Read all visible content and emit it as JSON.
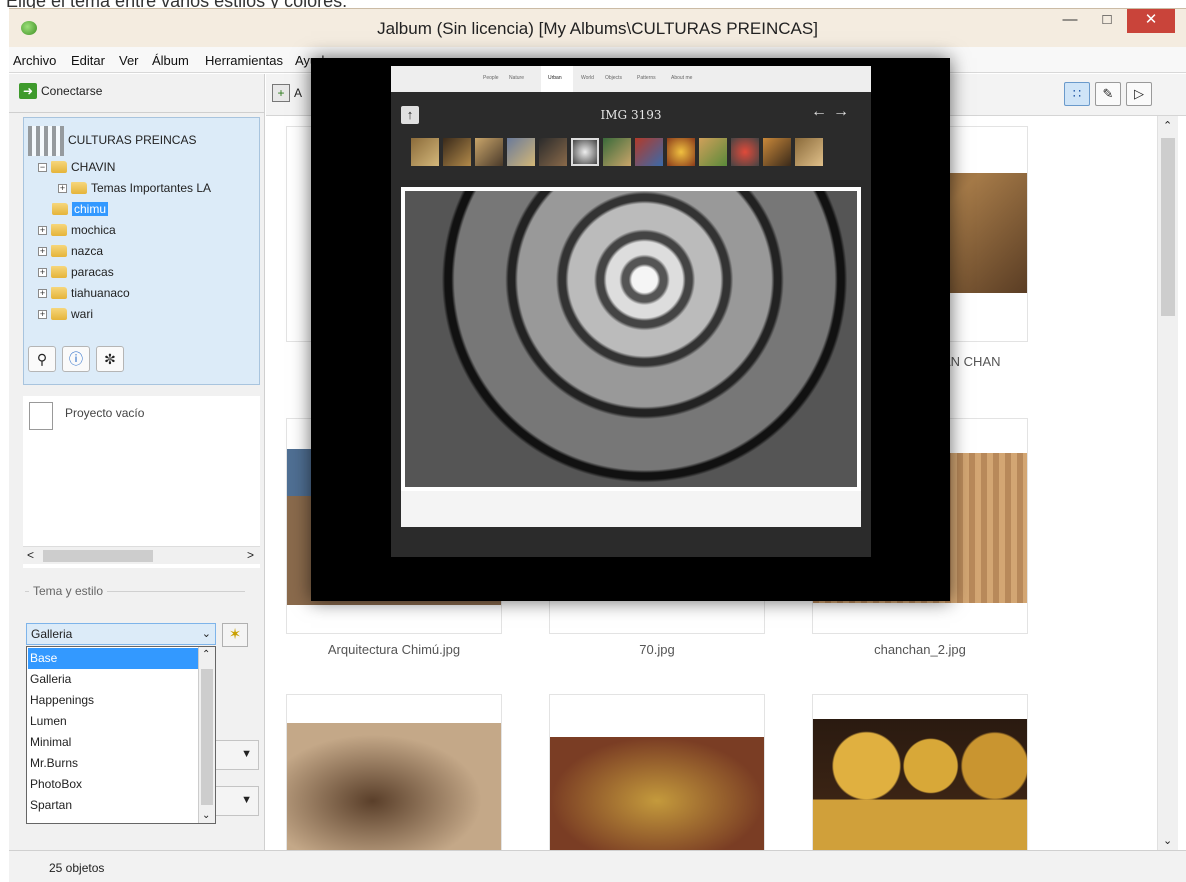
{
  "cropped_caption": "Elige el tema entre varios estilos y colores.",
  "window": {
    "title": "Jalbum (Sin licencia) [My Albums\\CULTURAS PREINCAS]"
  },
  "menu": [
    "Archivo",
    "Editar",
    "Ver",
    "Álbum",
    "Herramientas",
    "Ayuda"
  ],
  "left": {
    "connect_label": "Conectarse",
    "empty_project": "Proyecto vacío",
    "theme_section": "Tema y estilo"
  },
  "tree": {
    "root": "CULTURAS PREINCAS",
    "items": [
      "CHAVIN",
      "Temas Importantes LA",
      "chimu",
      "mochica",
      "nazca",
      "paracas",
      "tiahuanaco",
      "wari"
    ]
  },
  "theme": {
    "selected": "Galleria",
    "options": [
      "Base",
      "Galleria",
      "Happenings",
      "Lumen",
      "Minimal",
      "Mr.Burns",
      "PhotoBox",
      "Spartan"
    ]
  },
  "toolbar": {
    "add_label": "A"
  },
  "grid": {
    "captions": [
      "AN CHAN",
      "Arquitectura Chimú.jpg",
      "70.jpg",
      "chanchan_2.jpg"
    ]
  },
  "preview": {
    "nav": [
      "People",
      "Nature",
      "Urban",
      "World",
      "Objects",
      "Patterns",
      "About me"
    ],
    "title": "IMG 3193"
  },
  "status": {
    "count": "25 objetos"
  }
}
